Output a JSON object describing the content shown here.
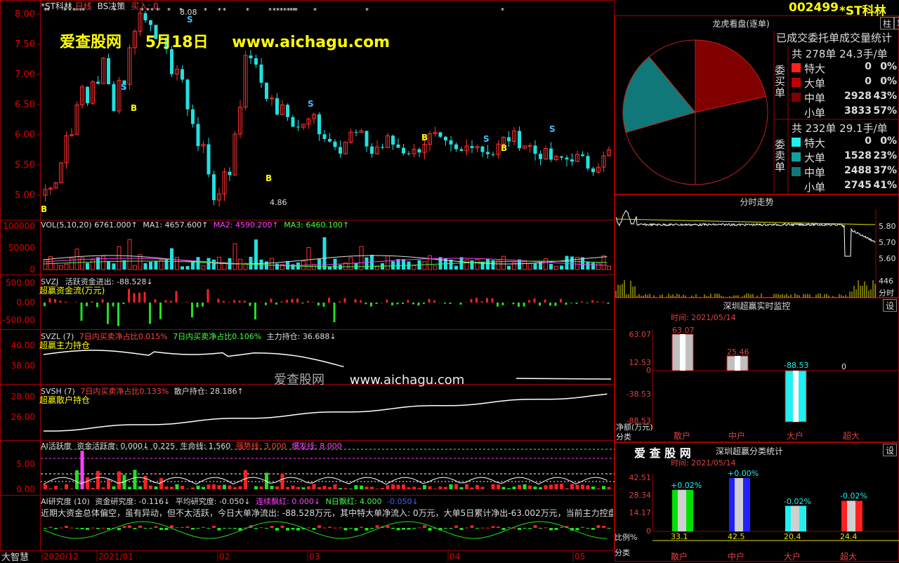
{
  "stock": {
    "code": "002499",
    "name": "*ST科林",
    "title_left": "*ST科林",
    "period": "日线",
    "strategy": "BS决策",
    "buy": "买入:",
    "buy_val": "0,"
  },
  "watermark": {
    "site": "爱查股网",
    "date": "5月18日",
    "url": "www.aichagu.com",
    "mid_url": "www.aichagu.com",
    "mid_cn": "爱查股网"
  },
  "toolbar": {
    "zhu": "柱",
    "bi": "笔"
  },
  "main_chart": {
    "yticks": [
      "8.00",
      "7.50",
      "7.00",
      "6.50",
      "6.00",
      "5.50",
      "5.00"
    ],
    "high_label": "8.08",
    "low_label": "4.86"
  },
  "vol": {
    "name": "VOL(5,10,20)",
    "v": "6761.000↑",
    "ma1": "MA1: 4657.600↑",
    "ma2": "MA2: 4590.200↑",
    "ma3": "MA3: 6460.100↑",
    "yticks": [
      "100000",
      "50000",
      "0"
    ]
  },
  "svzj": {
    "name": "SVZJ",
    "label": "活跃资金进出: -88.528↓",
    "sub": "超赢资金流(万元)",
    "yticks": [
      "500.00",
      "0.00",
      "-500.00"
    ]
  },
  "svzl": {
    "name": "SVZL (7)",
    "a": "7日内买卖净占比0.015%",
    "b": "7日内买卖净占比0.106%",
    "c": "主力持仓: 36.688↓",
    "sub": "超赢主力持仓",
    "yticks": [
      "40.00",
      "38.00"
    ]
  },
  "svsh": {
    "name": "SVSH (7)",
    "a": "7日内买卖净占比0.133%",
    "c": "散户持仓: 28.186↑",
    "sub": "超赢散户持仓",
    "yticks": [
      "28.00",
      "26.00"
    ]
  },
  "ai_active": {
    "name": "AI活跃度",
    "a": "资金活跃度: 0.000↓",
    "b": "0.225",
    "c": "生命线: 1.560",
    "d": "强势线: 3.000",
    "e": "爆发线: 8.000",
    "yticks": [
      "5.00",
      "0.00"
    ]
  },
  "ai_research": {
    "name": "AI研究度 (10)",
    "a": "资金研究度: -0.116↓",
    "b": "平均研究度: -0.050↓",
    "c": "连续飘红: 0.000↓",
    "d": "N日飘红: 4.000",
    "e": "-0.050↓",
    "desc": "近期大资金总体偏空，虽有异动，但不太活跃，今日大单净流出: -88.528万元，其中特大单净流入: 0万元，大单5日累计净出-63.002万元，当前主力控盘较"
  },
  "bottom": {
    "brand": "大智慧",
    "dates": [
      "2020/12",
      "2021/01",
      "02",
      "03",
      "04",
      "05"
    ]
  },
  "dragon": {
    "title": "龙虎看盘(逐单)",
    "sub": "已成交委托单成交量统计",
    "buy_label": "委买单",
    "sell_label": "委卖单",
    "buy_total": "共 278单 24.3手/单",
    "sell_total": "共 232单 29.1手/单",
    "buy_rows": [
      {
        "name": "特大",
        "n": "0",
        "p": "0%",
        "color": "#ff2020"
      },
      {
        "name": "大单",
        "n": "0",
        "p": "0%",
        "color": "#c00000"
      },
      {
        "name": "中单",
        "n": "2928",
        "p": "43%",
        "color": "#800000"
      },
      {
        "name": "小单",
        "n": "3833",
        "p": "57%",
        "color": "#000000"
      }
    ],
    "sell_rows": [
      {
        "name": "特大",
        "n": "0",
        "p": "0%",
        "color": "#20f0f0"
      },
      {
        "name": "大单",
        "n": "1528",
        "p": "23%",
        "color": "#10a0a0"
      },
      {
        "name": "中单",
        "n": "2488",
        "p": "37%",
        "color": "#107878"
      },
      {
        "name": "小单",
        "n": "2745",
        "p": "41%",
        "color": "#000000"
      }
    ]
  },
  "intraday": {
    "title": "分时走势",
    "yticks": [
      "5.80",
      "5.70",
      "5.60"
    ],
    "vol_label": "446",
    "time_label": "分时"
  },
  "monitor": {
    "title": "深圳超赢实时监控",
    "btn": "设",
    "time": "时间: 2021/05/14",
    "yticks": [
      "63.07",
      "12.53",
      "0",
      "-38.53",
      "-88.53"
    ],
    "unit": "净额(万元)",
    "cat_label": "分类",
    "categories": [
      "散户",
      "中户",
      "大户",
      "超大"
    ],
    "values": [
      63.07,
      25.46,
      -88.53,
      0
    ],
    "value_labels": [
      "63.07",
      "25.46",
      "-88.53",
      "0"
    ]
  },
  "classify": {
    "brand": "爱 查 股 网",
    "title": "深圳超赢分类统计",
    "btn": "设",
    "time": "时间: 2021/05/14",
    "yticks": [
      "42.51",
      "28.34",
      "14.17",
      "0"
    ],
    "ratio_label": "比例%",
    "cat_label": "分类",
    "categories": [
      "散户",
      "中户",
      "大户",
      "超大"
    ],
    "values": [
      33.1,
      42.5,
      20.4,
      24.4
    ],
    "value_labels": [
      "33.1",
      "42.5",
      "20.4",
      "24.4"
    ],
    "change_labels": [
      "+0.02%",
      "+0.00%",
      "-0.02%",
      "-0.02%"
    ],
    "colors": [
      "#00e000",
      "#2020ff",
      "#20f0f0",
      "#ff2020"
    ]
  },
  "chart_data": [
    {
      "type": "bar",
      "title": "深圳超赢实时监控",
      "ylabel": "净额(万元)",
      "categories": [
        "散户",
        "中户",
        "大户",
        "超大"
      ],
      "values": [
        63.07,
        25.46,
        -88.53,
        0
      ],
      "ylim": [
        -88.53,
        63.07
      ]
    },
    {
      "type": "bar",
      "title": "深圳超赢分类统计",
      "ylabel": "比例%",
      "categories": [
        "散户",
        "中户",
        "大户",
        "超大"
      ],
      "values": [
        33.1,
        42.5,
        20.4,
        24.4
      ],
      "ylim": [
        0,
        42.51
      ]
    },
    {
      "type": "pie",
      "title": "龙虎看盘(逐单)",
      "categories": [
        "中单(买)",
        "小单(买)",
        "大单(卖)",
        "中单(卖)",
        "小单(卖)"
      ],
      "values": [
        43,
        57,
        23,
        37,
        41
      ]
    }
  ]
}
